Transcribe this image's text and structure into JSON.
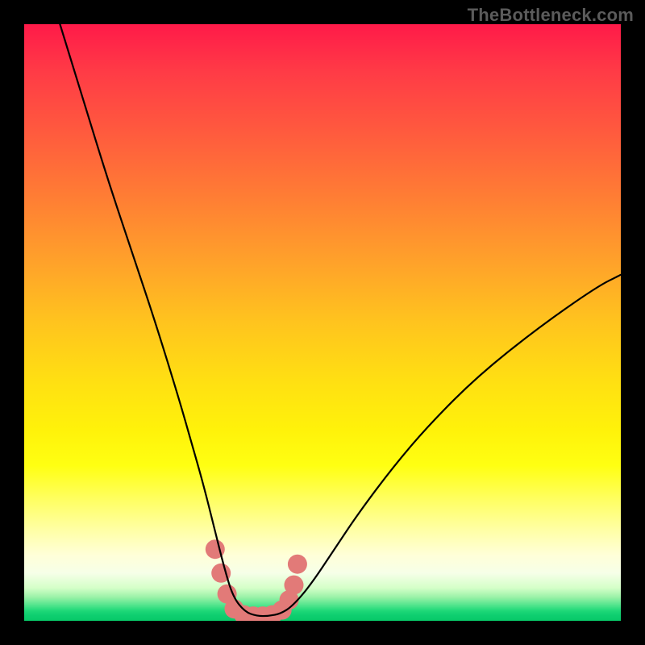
{
  "watermark": "TheBottleneck.com",
  "chart_data": {
    "type": "line",
    "title": "",
    "xlabel": "",
    "ylabel": "",
    "xlim": [
      0,
      100
    ],
    "ylim": [
      0,
      100
    ],
    "grid": false,
    "series": [
      {
        "name": "bottleneck-curve",
        "x": [
          6,
          10,
          14,
          18,
          22,
          26,
          28,
          30,
          32,
          33.5,
          35,
          37,
          39,
          41,
          43,
          45,
          48,
          52,
          56,
          62,
          68,
          76,
          86,
          96,
          100
        ],
        "y": [
          100,
          87,
          74,
          62,
          50,
          37,
          30,
          23,
          15,
          9,
          4,
          1.5,
          0.8,
          0.8,
          1.2,
          2.5,
          6,
          12,
          18,
          26,
          33,
          41,
          49,
          56,
          58
        ]
      }
    ],
    "annotations": [
      {
        "name": "marker-band",
        "color": "#e27a78",
        "points_x": [
          32.0,
          33.0,
          34.0,
          35.2,
          36.8,
          38.4,
          40.0,
          41.6,
          43.2,
          44.4,
          45.2,
          45.8
        ],
        "points_y": [
          12.0,
          8.0,
          4.5,
          2.0,
          1.0,
          0.8,
          0.8,
          1.0,
          1.8,
          3.5,
          6.0,
          9.5
        ],
        "radius": 12
      }
    ],
    "gradient_stops": [
      {
        "pos": 0,
        "color": "#ff1a49"
      },
      {
        "pos": 50,
        "color": "#ffc41e"
      },
      {
        "pos": 74,
        "color": "#ffff12"
      },
      {
        "pos": 92,
        "color": "#f6ffe8"
      },
      {
        "pos": 100,
        "color": "#08c968"
      }
    ]
  }
}
